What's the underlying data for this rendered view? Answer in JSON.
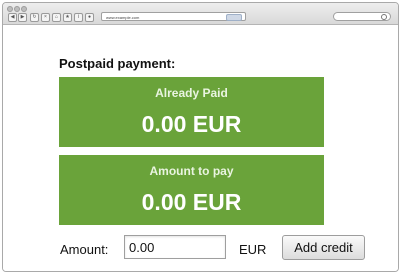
{
  "browser": {
    "address_text": "www.example.com",
    "back_icon": "back-arrow-icon",
    "forward_icon": "forward-arrow-icon",
    "reload_icon": "reload-icon",
    "search_icon": "search-icon"
  },
  "page": {
    "heading": "Postpaid payment:",
    "already_paid": {
      "label": "Already Paid",
      "value": "0.00 EUR"
    },
    "amount_to_pay": {
      "label": "Amount to pay",
      "value": "0.00 EUR"
    },
    "form": {
      "amount_label": "Amount:",
      "amount_value": "0.00",
      "currency": "EUR",
      "submit_label": "Add credit"
    }
  },
  "colors": {
    "panel_green": "#6aa33a",
    "panel_text": "#ffffff"
  }
}
